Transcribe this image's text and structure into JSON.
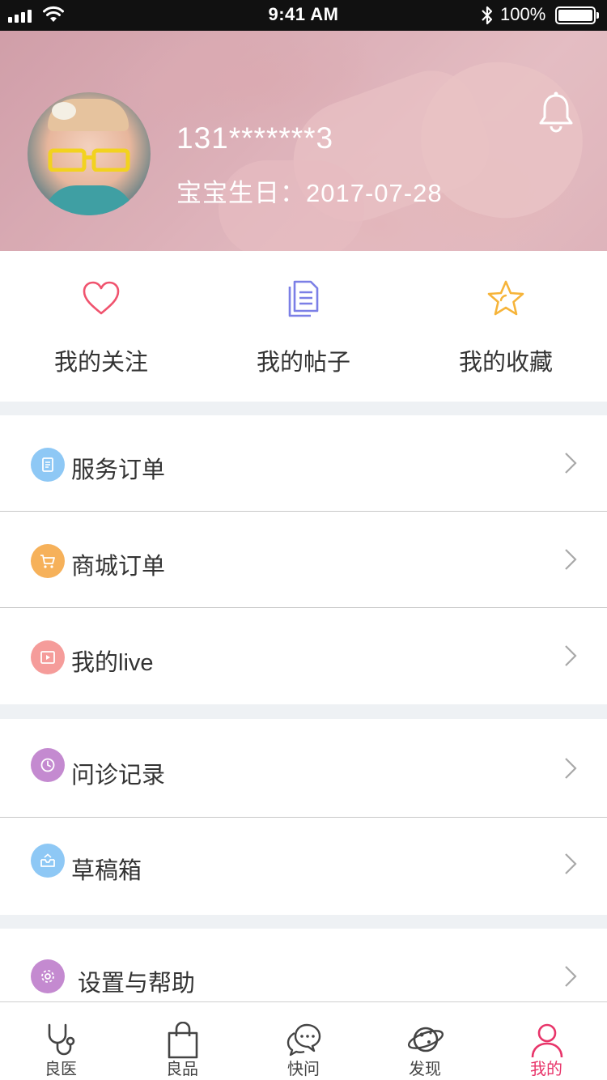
{
  "status_bar": {
    "time": "9:41 AM",
    "battery_text": "100%",
    "battery_level": 1.0
  },
  "profile": {
    "phone": "131*******3",
    "birthday_label": "宝宝生日：",
    "birthday_value": "2017-07-28"
  },
  "quick_actions": [
    {
      "label": "我的关注",
      "icon": "heart-icon",
      "color": "#f0536e"
    },
    {
      "label": "我的帖子",
      "icon": "document-icon",
      "color": "#7b7fe6"
    },
    {
      "label": "我的收藏",
      "icon": "star-icon",
      "color": "#f6b43a"
    }
  ],
  "menu_groups": [
    [
      {
        "label": "服务订单",
        "icon": "order-list-icon",
        "color": "#8ec8f5"
      },
      {
        "label": "商城订单",
        "icon": "cart-icon",
        "color": "#f6b15a"
      },
      {
        "label": "我的live",
        "icon": "play-icon",
        "color": "#f59c9a"
      }
    ],
    [
      {
        "label": "问诊记录",
        "icon": "clock-icon",
        "color": "#c48ad0"
      },
      {
        "label": "草稿箱",
        "icon": "inbox-icon",
        "color": "#8ec8f5"
      }
    ],
    [
      {
        "label": "设置与帮助",
        "icon": "gear-icon",
        "color": "#c48ad0"
      }
    ]
  ],
  "tab_bar": {
    "active_index": 4,
    "active_color": "#e8356a",
    "items": [
      {
        "label": "良医",
        "icon": "stethoscope-icon"
      },
      {
        "label": "良品",
        "icon": "shopping-bag-icon"
      },
      {
        "label": "快问",
        "icon": "chat-bubble-icon"
      },
      {
        "label": "发现",
        "icon": "planet-icon"
      },
      {
        "label": "我的",
        "icon": "person-icon"
      }
    ]
  }
}
